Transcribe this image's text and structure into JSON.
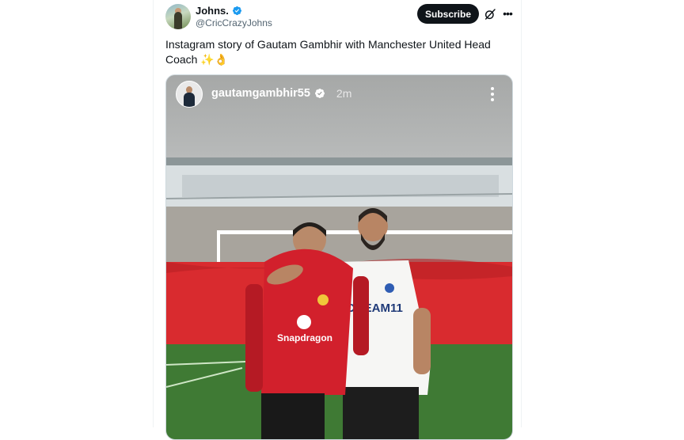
{
  "post": {
    "author_name": "Johns.",
    "author_handle": "@CricCrazyJohns",
    "subscribe_label": "Subscribe",
    "text": "Instagram story of Gautam Gambhir with Manchester United Head Coach ✨👌"
  },
  "story": {
    "username": "gautamgambhir55",
    "time": "2m",
    "shirt_left_sponsor": "Snapdragon",
    "shirt_right_sponsor": "DREAM11"
  },
  "colors": {
    "verified": "#1d9bf0",
    "subscribe_bg": "#0f1419",
    "jersey_red": "#d2202c",
    "jersey_white": "#f6f6f4",
    "pitch_green": "#3f7a34",
    "banner_red": "#d92b2f"
  },
  "icons": {
    "verified": "verified-badge-icon",
    "grok": "grok-icon",
    "more": "more-options-icon",
    "story_more": "vertical-dots-icon"
  }
}
